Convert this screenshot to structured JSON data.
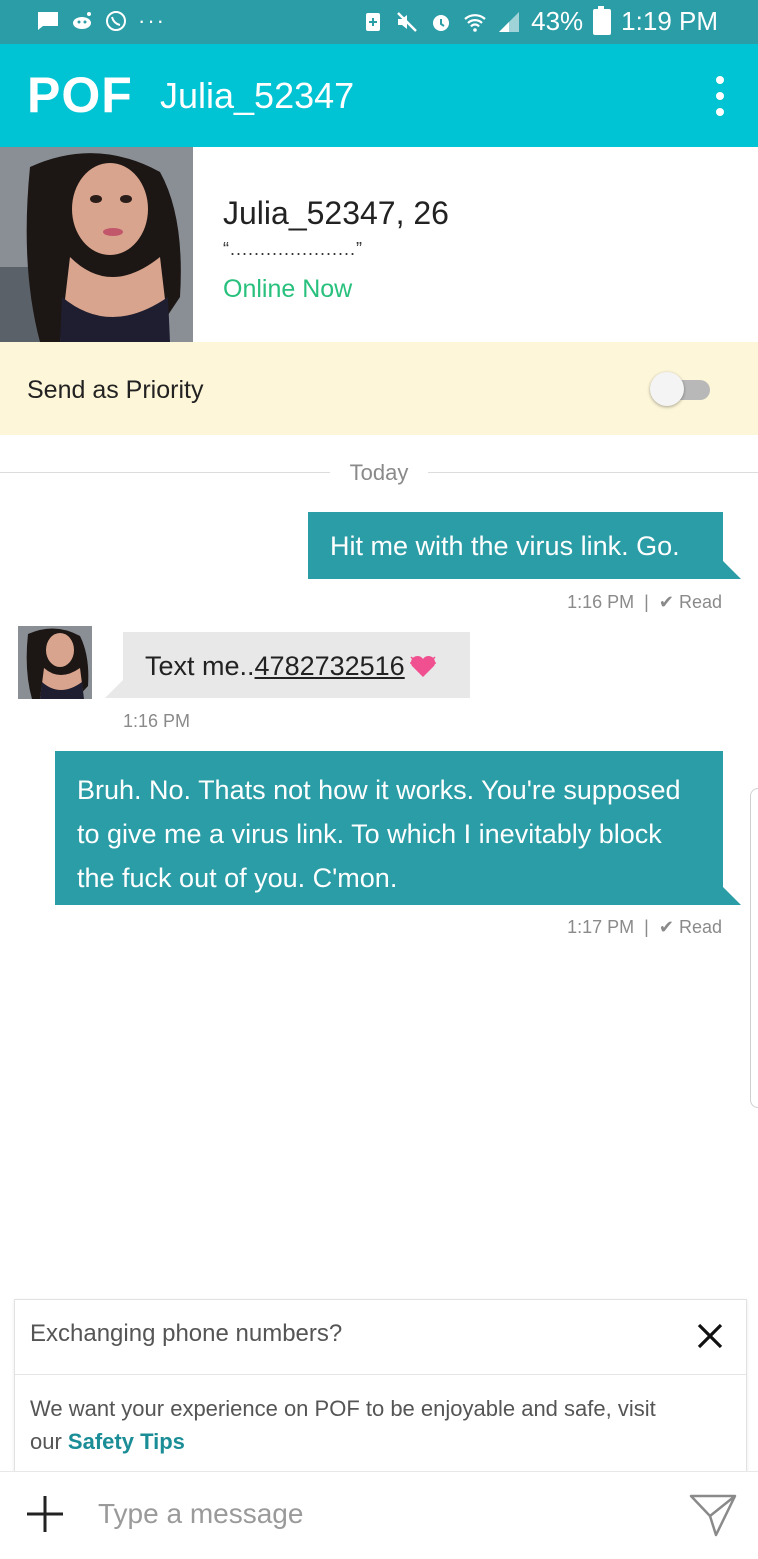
{
  "status_bar": {
    "battery_percent": "43%",
    "time": "1:19 PM",
    "left_icons": [
      "message-icon",
      "reddit-icon",
      "whatsapp-icon",
      "more-dots-icon"
    ],
    "right_icons": [
      "battery-saver-icon",
      "mute-icon",
      "alarm-icon",
      "wifi-icon",
      "signal-icon",
      "battery-icon"
    ]
  },
  "app_bar": {
    "logo": "POF",
    "title": "Julia_52347",
    "background": "#00c3d3"
  },
  "profile": {
    "name_age": "Julia_52347, 26",
    "headline": "“.....................”",
    "status": "Online Now",
    "status_color": "#27c07c"
  },
  "priority": {
    "label": "Send as Priority",
    "enabled": false
  },
  "conversation": {
    "day_label": "Today",
    "messages": [
      {
        "direction": "outgoing",
        "text": "Hit me with the virus link. Go.",
        "time": "1:16 PM",
        "separator": "|",
        "receipt": "Read"
      },
      {
        "direction": "incoming",
        "text_prefix": "Text me..",
        "phone": "4782732516",
        "emoji": "sparkling-heart-icon",
        "time": "1:16 PM"
      },
      {
        "direction": "outgoing",
        "text": "Bruh. No. Thats not how it works. You're supposed to give me a virus link. To which I inevitably block the fuck out of you. C'mon.",
        "time": "1:17 PM",
        "separator": "|",
        "receipt": "Read"
      }
    ],
    "outgoing_color": "#2a9da6",
    "incoming_color": "#e8e8e8"
  },
  "safety_notice": {
    "title": "Exchanging phone numbers?",
    "body": "We want your experience on POF to be enjoyable and safe, visit our ",
    "link_text": "Safety Tips"
  },
  "composer": {
    "placeholder": "Type a message"
  }
}
